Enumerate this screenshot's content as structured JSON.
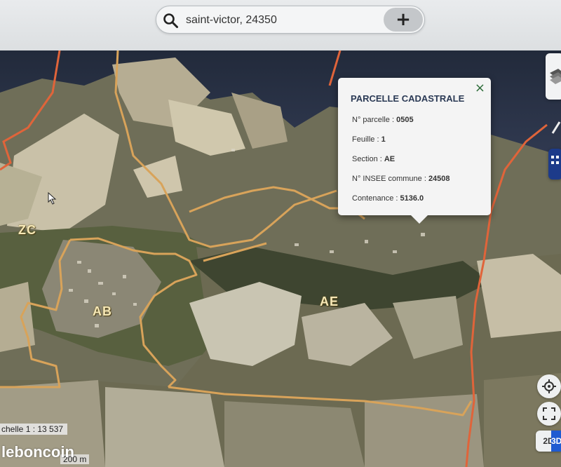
{
  "search": {
    "value": "saint-victor, 24350",
    "placeholder": "",
    "add_label": "+"
  },
  "map": {
    "sections": [
      "ZC",
      "AB",
      "AE"
    ],
    "scale_text": "chelle 1 : 13 537",
    "scale_bar_label": "200 m"
  },
  "popup": {
    "title": "PARCELLE CADASTRALE",
    "close": "×",
    "rows": [
      {
        "label": "N° parcelle : ",
        "value": "0505"
      },
      {
        "label": "Feuille : ",
        "value": "1"
      },
      {
        "label": "Section : ",
        "value": "AE"
      },
      {
        "label": "N° INSEE commune : ",
        "value": "24508"
      },
      {
        "label": "Contenance : ",
        "value": "5136.0"
      }
    ]
  },
  "view": {
    "toggle_2d": "2D",
    "toggle_3d": "3D"
  },
  "watermark": "leboncoin",
  "icons": [
    "search-icon",
    "layers-icon",
    "measure-icon",
    "grid-icon",
    "locate-icon",
    "fullscreen-icon"
  ],
  "colors": {
    "boundary_section": "#d8a35a",
    "boundary_commune": "#e0643a",
    "popup_title": "#2b3a55",
    "toggle_active": "#1f5bd1"
  }
}
